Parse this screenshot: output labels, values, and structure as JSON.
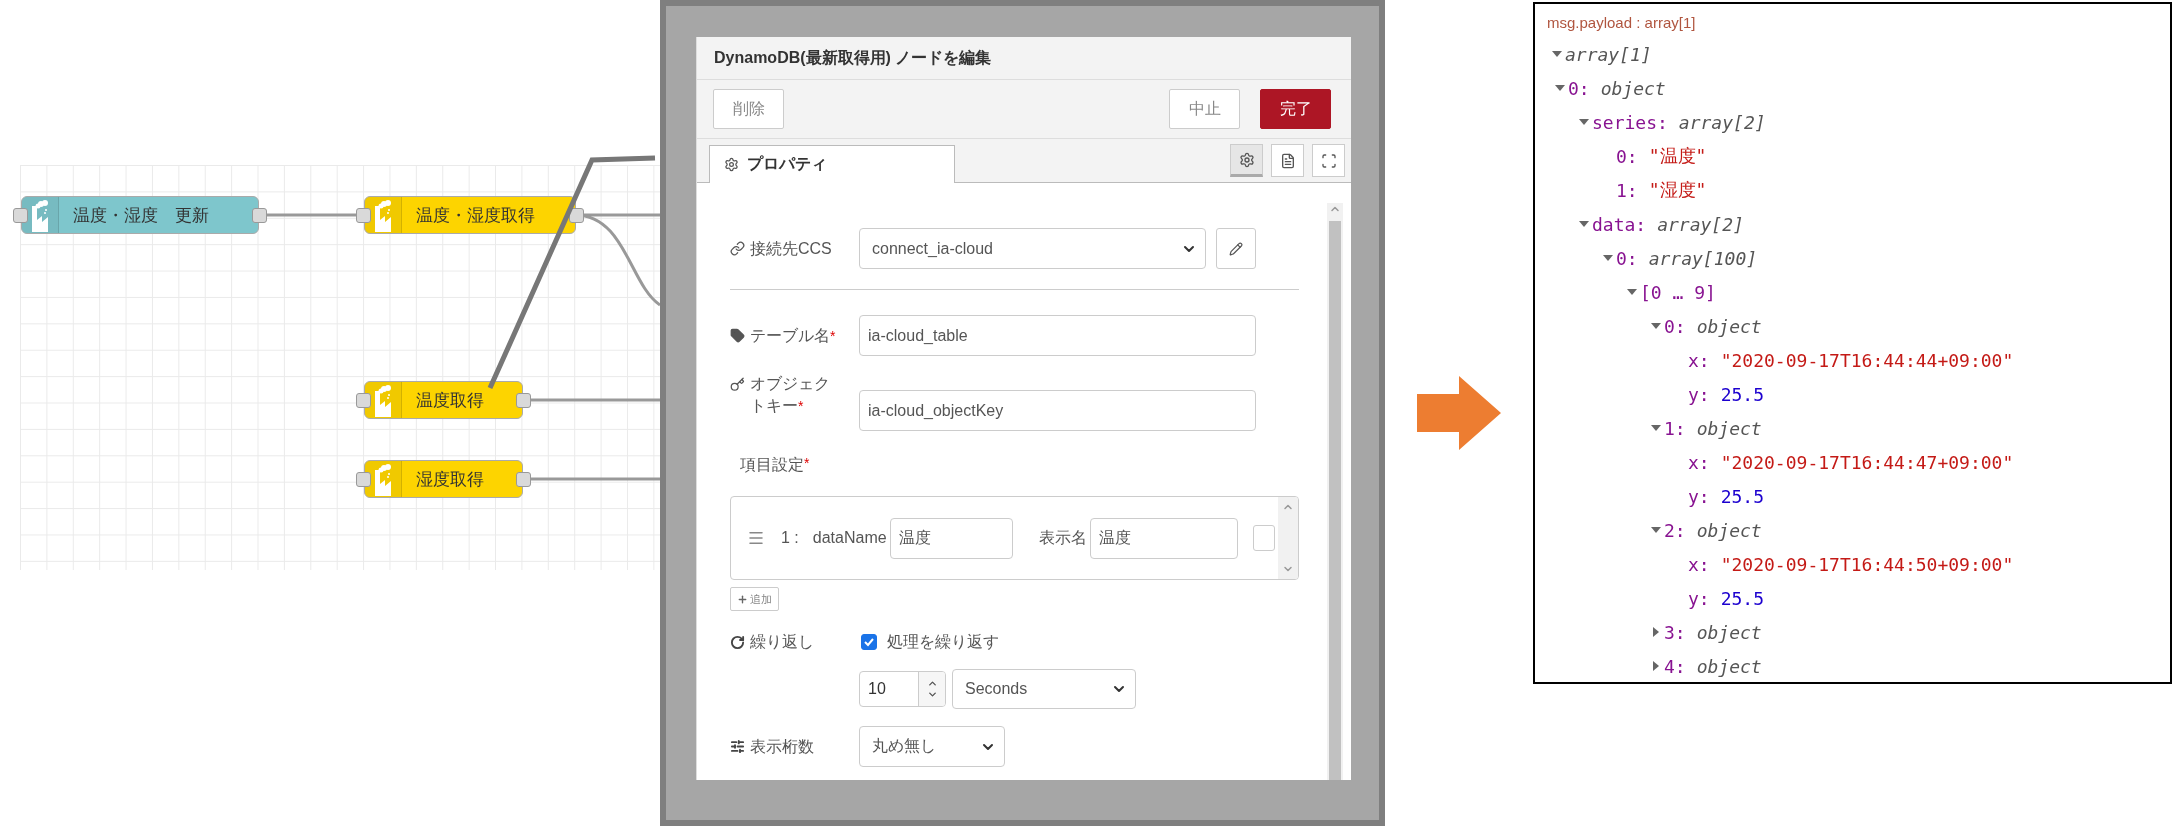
{
  "canvas": {
    "nodes": [
      {
        "label": "温度・湿度　更新",
        "color": "#7ec6cc"
      },
      {
        "label": "温度・湿度取得",
        "color": "#fdd400"
      },
      {
        "label": "温度取得",
        "color": "#fdd400"
      },
      {
        "label": "湿度取得",
        "color": "#fdd400"
      }
    ]
  },
  "dialog": {
    "title": "DynamoDB(最新取得用) ノードを編集",
    "buttons": [
      {
        "label": "削除",
        "kind": "plain"
      },
      {
        "label": "中止",
        "kind": "plain"
      },
      {
        "label": "完了",
        "kind": "primary"
      }
    ],
    "tabs": [
      {
        "label": "プロパティ",
        "selected": true
      }
    ],
    "side_tabs": [
      {
        "selected": true
      },
      {
        "selected": false
      },
      {
        "selected": false
      }
    ],
    "connection": {
      "label": "接続先CCS",
      "value": "connect_ia-cloud"
    },
    "table_name": {
      "label": "テーブル名",
      "required_mark": "*",
      "value": "ia-cloud_table"
    },
    "object_key": {
      "label": "オブジェクトキー",
      "required_mark": "*",
      "value": "ia-cloud_objectKey"
    },
    "items": {
      "label": "項目設定",
      "required_mark": "*",
      "add_button": "追加",
      "rows": [
        {
          "index": "1 :",
          "name_label": "dataName",
          "name_value": "温度",
          "display_label": "表示名",
          "display_value": "温度"
        }
      ]
    },
    "repeat": {
      "label": "繰り返し",
      "checkbox_label": "処理を繰り返す",
      "checked": true,
      "interval": "10",
      "unit": "Seconds"
    },
    "digits": {
      "label": "表示桁数",
      "value": "丸め無し"
    }
  },
  "payload": {
    "title": "msg.payload : array[1]",
    "tree": [
      {
        "value": "array[1]",
        "kind": "type",
        "expanded": true,
        "children": [
          {
            "key": "0:",
            "value": "object",
            "kind": "type",
            "expanded": true,
            "children": [
              {
                "key": "series:",
                "value": "array[2]",
                "kind": "type",
                "expanded": true,
                "children": [
                  {
                    "key": "0:",
                    "value": "\"温度\"",
                    "kind": "string"
                  },
                  {
                    "key": "1:",
                    "value": "\"湿度\"",
                    "kind": "string"
                  }
                ]
              },
              {
                "key": "data:",
                "value": "array[2]",
                "kind": "type",
                "expanded": true,
                "children": [
                  {
                    "key": "0:",
                    "value": "array[100]",
                    "kind": "type",
                    "expanded": true,
                    "children": [
                      {
                        "value": "[0 … 9]",
                        "kind": "range",
                        "expanded": true,
                        "children": [
                          {
                            "key": "0:",
                            "value": "object",
                            "kind": "type",
                            "expanded": true,
                            "children": [
                              {
                                "key": "x:",
                                "value": "\"2020-09-17T16:44:44+09:00\"",
                                "kind": "string"
                              },
                              {
                                "key": "y:",
                                "value": "25.5",
                                "kind": "number"
                              }
                            ]
                          },
                          {
                            "key": "1:",
                            "value": "object",
                            "kind": "type",
                            "expanded": true,
                            "children": [
                              {
                                "key": "x:",
                                "value": "\"2020-09-17T16:44:47+09:00\"",
                                "kind": "string"
                              },
                              {
                                "key": "y:",
                                "value": "25.5",
                                "kind": "number"
                              }
                            ]
                          },
                          {
                            "key": "2:",
                            "value": "object",
                            "kind": "type",
                            "expanded": true,
                            "children": [
                              {
                                "key": "x:",
                                "value": "\"2020-09-17T16:44:50+09:00\"",
                                "kind": "string"
                              },
                              {
                                "key": "y:",
                                "value": "25.5",
                                "kind": "number"
                              }
                            ]
                          },
                          {
                            "key": "3:",
                            "value": "object",
                            "kind": "type",
                            "expanded": false
                          },
                          {
                            "key": "4:",
                            "value": "object",
                            "kind": "type",
                            "expanded": false
                          }
                        ]
                      }
                    ]
                  }
                ]
              }
            ]
          }
        ]
      }
    ]
  }
}
